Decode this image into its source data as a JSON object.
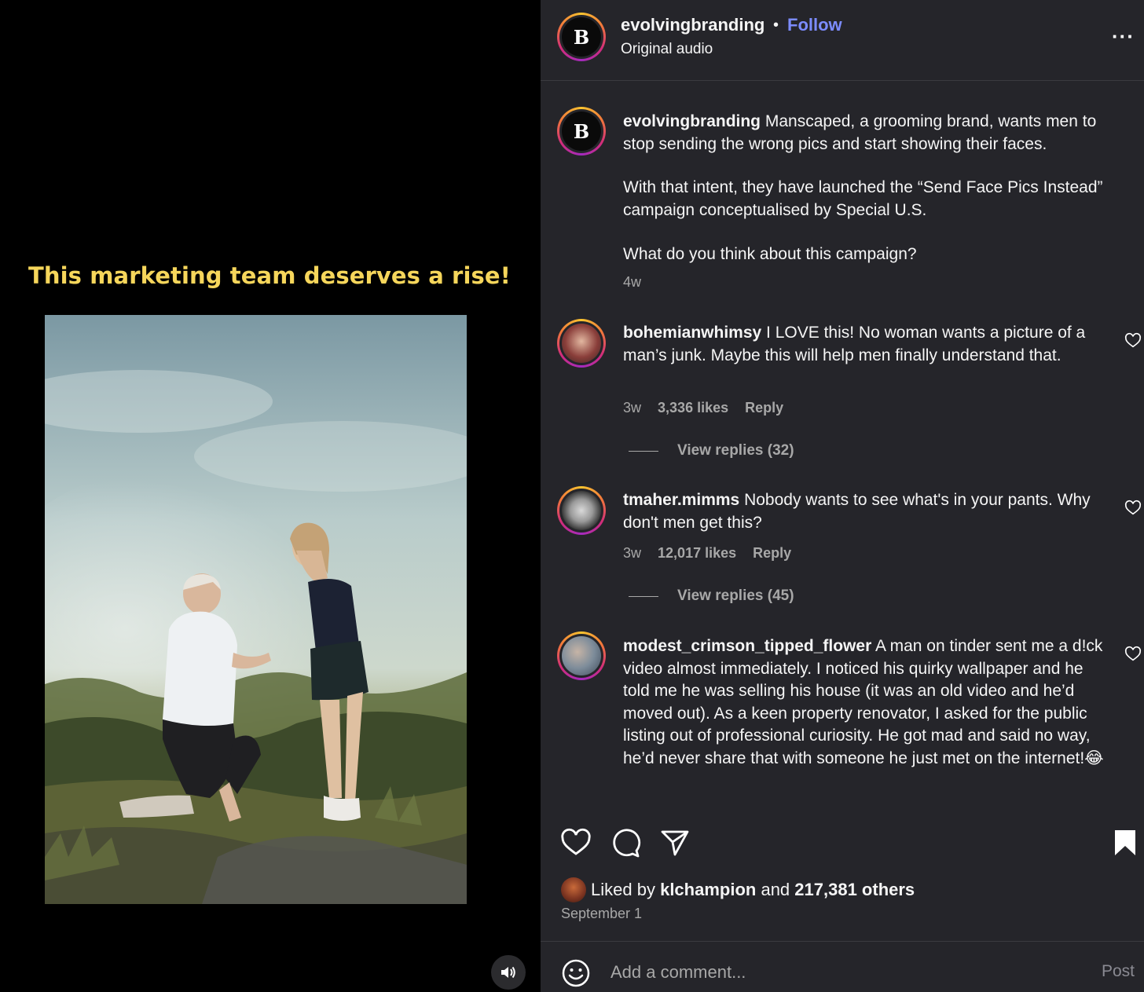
{
  "media": {
    "overlay_text": "This marketing team deserves a rise!",
    "mute_icon": "speaker-icon"
  },
  "header": {
    "username": "evolvingbranding",
    "separator": "•",
    "follow_label": "Follow",
    "audio_label": "Original audio",
    "avatar_letter": "B",
    "more_icon": "more-options-icon"
  },
  "caption": {
    "username": "evolvingbranding",
    "avatar_letter": "B",
    "paragraph1": "Manscaped, a grooming brand, wants men to stop sending the wrong pics and start showing their faces.",
    "paragraph2": "With that intent, they have launched the “Send Face Pics Instead” campaign conceptualised by Special U.S.",
    "paragraph3": "What do you think about this campaign?",
    "time": "4w"
  },
  "comments": [
    {
      "username": "bohemianwhimsy",
      "text": "I LOVE this! No woman wants a picture of a man’s junk. Maybe this will help men finally understand that.",
      "time": "3w",
      "likes": "3,336 likes",
      "reply": "Reply",
      "view_replies": "View replies (32)"
    },
    {
      "username": "tmaher.mimms",
      "text": "Nobody wants to see what's in your pants. Why don't men get this?",
      "time": "3w",
      "likes": "12,017 likes",
      "reply": "Reply",
      "view_replies": "View replies (45)"
    },
    {
      "username": "modest_crimson_tipped_flower",
      "text": "A man on tinder sent me a d!ck video almost immediately. I noticed his quirky wallpaper and he told me he was selling his house (it was an old video and he’d moved out). As a keen property renovator, I asked for the public listing out of professional curiosity. He got mad and said no way, he’d never share that with someone he just met on the internet!😂"
    }
  ],
  "actions": {
    "liked_prefix": "Liked by",
    "liked_user": "klchampion",
    "liked_and": "and",
    "liked_others": "217,381 others",
    "date": "September 1"
  },
  "comment_box": {
    "placeholder": "Add a comment...",
    "post_label": "Post"
  },
  "colors": {
    "accent_follow": "#7c8cff",
    "overlay_text": "#f6d65b",
    "panel_bg": "#25252a"
  }
}
